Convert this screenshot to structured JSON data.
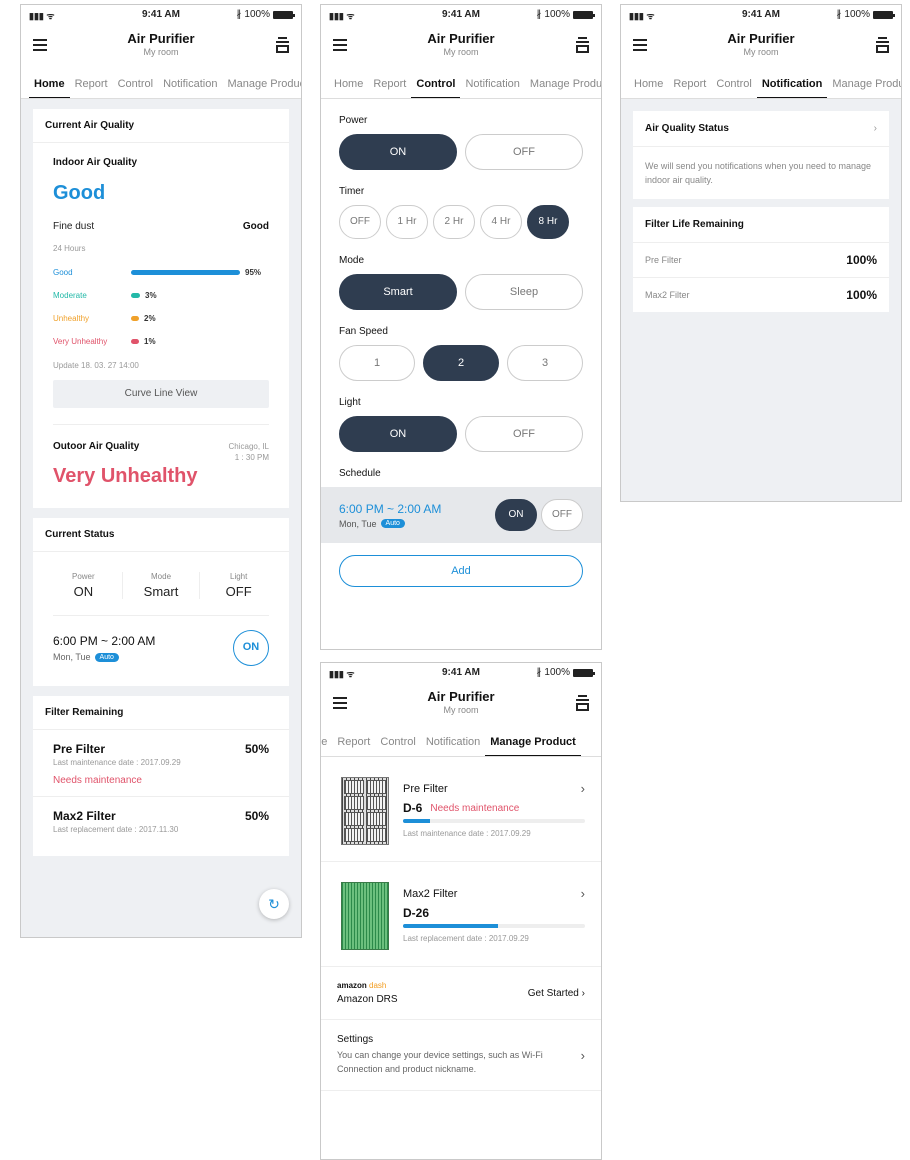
{
  "status_bar": {
    "time": "9:41 AM",
    "battery": "100%"
  },
  "app": {
    "title": "Air Purifier",
    "subtitle": "My room"
  },
  "tabs": [
    "Home",
    "Report",
    "Control",
    "Notification",
    "Manage Product"
  ],
  "home": {
    "current_air_quality_title": "Current Air Quality",
    "indoor_label": "Indoor Air Quality",
    "indoor_status": "Good",
    "fine_dust_label": "Fine dust",
    "fine_dust_value": "Good",
    "hours_label": "24 Hours",
    "breakdown": [
      {
        "label": "Good",
        "percent": 95,
        "pct_text": "95%",
        "color": "#1d8fd8"
      },
      {
        "label": "Moderate",
        "percent": 3,
        "pct_text": "3%",
        "color": "#23b9a8"
      },
      {
        "label": "Unhealthy",
        "percent": 2,
        "pct_text": "2%",
        "color": "#f0a12b"
      },
      {
        "label": "Very Unhealthy",
        "percent": 1,
        "pct_text": "1%",
        "color": "#e0536a"
      }
    ],
    "update_text": "Update 18. 03. 27 14:00",
    "curve_button": "Curve Line View",
    "outdoor_label": "Outoor Air Quality",
    "outdoor_location": "Chicago, IL",
    "outdoor_time": "1 : 30 PM",
    "outdoor_status": "Very Unhealthy",
    "current_status_title": "Current Status",
    "status": [
      {
        "key": "Power",
        "value": "ON"
      },
      {
        "key": "Mode",
        "value": "Smart"
      },
      {
        "key": "Light",
        "value": "OFF"
      }
    ],
    "schedule_time": "6:00 PM ~ 2:00 AM",
    "schedule_days": "Mon, Tue",
    "auto_badge": "Auto",
    "schedule_toggle": "ON",
    "filter_title": "Filter Remaining",
    "filters": [
      {
        "name": "Pre Filter",
        "percent": "50%",
        "date": "Last maintenance date : 2017.09.29",
        "warning": "Needs maintenance"
      },
      {
        "name": "Max2 Filter",
        "percent": "50%",
        "date": "Last replacement date : 2017.11.30",
        "warning": ""
      }
    ]
  },
  "control": {
    "power_label": "Power",
    "power_on": "ON",
    "power_off": "OFF",
    "timer_label": "Timer",
    "timer_options": [
      "OFF",
      "1 Hr",
      "2 Hr",
      "4 Hr",
      "8 Hr"
    ],
    "timer_selected": "8 Hr",
    "mode_label": "Mode",
    "mode_smart": "Smart",
    "mode_sleep": "Sleep",
    "fan_label": "Fan Speed",
    "fan_options": [
      "1",
      "2",
      "3"
    ],
    "fan_selected": "2",
    "light_label": "Light",
    "light_on": "ON",
    "light_off": "OFF",
    "schedule_label": "Schedule",
    "schedule_time": "6:00 PM ~ 2:00 AM",
    "schedule_days": "Mon, Tue",
    "auto_badge": "Auto",
    "schedule_on": "ON",
    "schedule_off": "OFF",
    "add_button": "Add"
  },
  "notification": {
    "aq_status_title": "Air Quality Status",
    "aq_status_desc": "We will send you notifications when you need to manage indoor air quality.",
    "filter_life_title": "Filter Life Remaining",
    "filters": [
      {
        "name": "Pre Filter",
        "value": "100%"
      },
      {
        "name": "Max2 Filter",
        "value": "100%"
      }
    ]
  },
  "manage": {
    "items": [
      {
        "name": "Pre Filter",
        "code": "D-6",
        "warning": "Needs maintenance",
        "progress": 0.15,
        "date": "Last maintenance date : 2017.09.29"
      },
      {
        "name": "Max2 Filter",
        "code": "D-26",
        "warning": "",
        "progress": 0.52,
        "date": "Last replacement date : 2017.09.29"
      }
    ],
    "amazon_logo": "amazon",
    "amazon_logo_dash": "dash",
    "amazon_label": "Amazon DRS",
    "get_started": "Get Started",
    "settings_title": "Settings",
    "settings_desc": "You can change your device settings, such as Wi-Fi Connection and product nickname."
  },
  "icons": {
    "menu": "menu-icon",
    "device": "device-icon",
    "chevron": "chevron-right-icon",
    "refresh": "refresh-icon",
    "signal": "signal-icon",
    "battery": "battery-icon",
    "bluetooth": "bluetooth-icon"
  }
}
